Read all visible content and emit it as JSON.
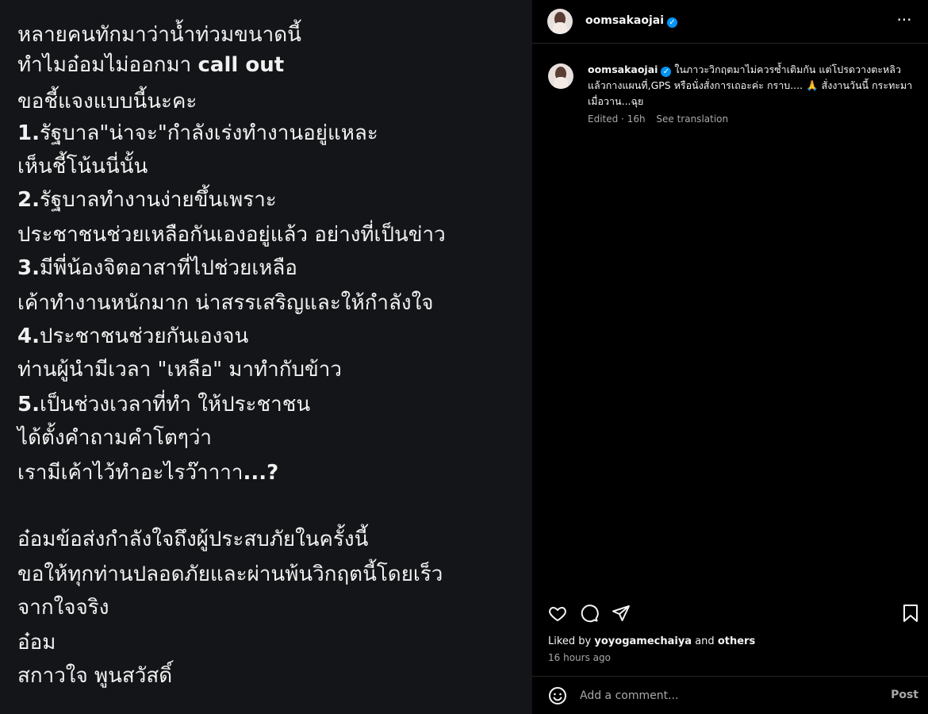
{
  "post_image": {
    "lines": [
      {
        "num": "",
        "text": "หลายคนทักมาว่าน้ำท่วมขนาดนี้"
      },
      {
        "num": "",
        "text": "ทำไมอ๋อมไม่ออกมา ",
        "strong": "call out"
      },
      {
        "num": "",
        "text": "ขอชี้แจงแบบนี้นะคะ"
      },
      {
        "num": "1.",
        "text": "รัฐบาล\"น่าจะ\"กำลังเร่งทำงานอยู่แหละ"
      },
      {
        "num": "",
        "text": "เห็นชี้โน้นนี่นั้น"
      },
      {
        "num": "2.",
        "text": "รัฐบาลทำงานง่ายขึ้นเพราะ"
      },
      {
        "num": "",
        "text": "ประชาชนช่วยเหลือกันเองอยู่แล้ว อย่างที่เป็นข่าว"
      },
      {
        "num": "3.",
        "text": "มีพี่น้องจิตอาสาที่ไปช่วยเหลือ"
      },
      {
        "num": "",
        "text": "เค้าทำงานหนักมาก น่าสรรเสริญและให้กำลังใจ"
      },
      {
        "num": "4.",
        "text": "ประชาชนช่วยกันเองจน"
      },
      {
        "num": "",
        "text": "ท่านผู้นำมีเวลา \"เหลือ\" มาทำกับข้าว"
      },
      {
        "num": "5.",
        "text": "เป็นช่วงเวลาที่ทำ ให้ประชาชน"
      },
      {
        "num": "",
        "text": "ได้ตั้งคำถามคำโตๆว่า"
      },
      {
        "num": "",
        "text": "เรามีเค้าไว้ทำอะไรว๊าาาา",
        "strong": "...?"
      },
      {
        "num": "",
        "text": "อ๋อมข้อส่งกำลังใจถึงผู้ประสบภัยในครั้งนี้"
      },
      {
        "num": "",
        "text": "ขอให้ทุกท่านปลอดภัยและผ่านพ้นวิกฤตนี้โดยเร็ว"
      },
      {
        "num": "",
        "text": "จากใจจริง"
      },
      {
        "num": "",
        "text": "อ๋อม"
      },
      {
        "num": "",
        "text": "สกาวใจ พูนสวัสดิ์"
      }
    ]
  },
  "header": {
    "username": "oomsakaojai",
    "verified_icon": "verified-badge-icon",
    "more_icon": "more-options-icon",
    "more_glyph": "···"
  },
  "caption": {
    "username": "oomsakaojai",
    "text": "ในภาวะวิกฤตมาไม่ควรซ้ำเติมกัน แต่โปรดวางตะหลิวแล้วกางแผนที่,GPS หรือนั่งสั่งการเถอะค่ะ กราบ.... 🙏 สั่งงานวันนี้ กระทะมาเมื่อวาน...ฉุย",
    "edited": "Edited · 16h",
    "see_translation": "See translation"
  },
  "actions": {
    "like_icon": "heart-icon",
    "comment_icon": "comment-icon",
    "share_icon": "share-icon",
    "save_icon": "bookmark-icon"
  },
  "likes": {
    "prefix": "Liked by",
    "user": "yoyogamechaiya",
    "and": "and",
    "others": "others"
  },
  "timestamp": "16 hours ago",
  "comment_box": {
    "emoji_icon": "emoji-icon",
    "placeholder": "Add a comment...",
    "post_label": "Post"
  },
  "colors": {
    "image_bg": "#141518",
    "panel_bg": "#000000",
    "verified": "#0095f6",
    "muted": "#a8a8a8"
  }
}
